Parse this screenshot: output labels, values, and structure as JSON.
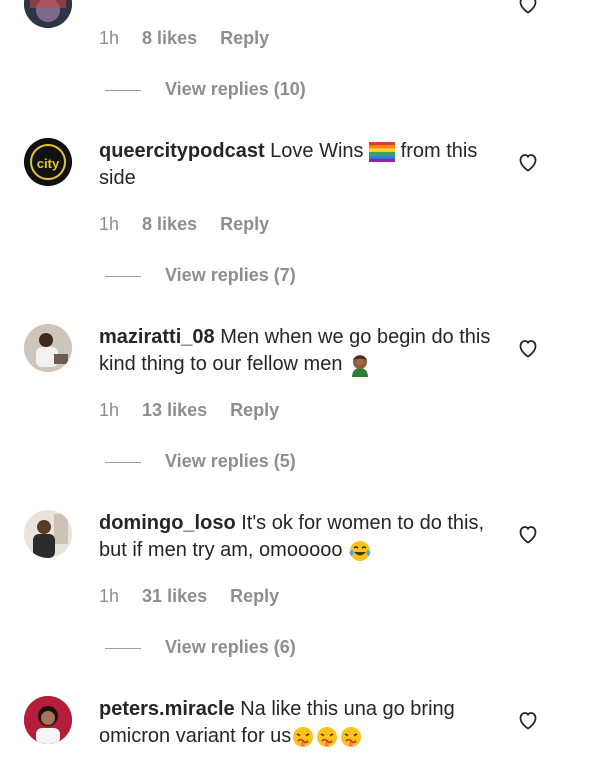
{
  "comments": [
    {
      "username": "",
      "text": "",
      "time": "1h",
      "likes": "8 likes",
      "reply": "Reply",
      "view_replies": "View replies (10)"
    },
    {
      "username": "queercitypodcast",
      "text": "Love Wins",
      "text_after": "from this side",
      "avatar_text": "city",
      "time": "1h",
      "likes": "8 likes",
      "reply": "Reply",
      "view_replies": "View replies (7)"
    },
    {
      "username": "maziratti_08",
      "text": "Men when we go begin do this kind thing to our fellow men",
      "time": "1h",
      "likes": "13 likes",
      "reply": "Reply",
      "view_replies": "View replies (5)"
    },
    {
      "username": "domingo_loso",
      "text": "It's ok for women to do this, but if men try am, omooooo",
      "time": "1h",
      "likes": "31 likes",
      "reply": "Reply",
      "view_replies": "View replies (6)"
    },
    {
      "username": "peters.miracle",
      "text": "Na like this una go bring omicron variant for us",
      "time": "",
      "likes": "",
      "reply": "",
      "view_replies": ""
    }
  ],
  "icons": {
    "like": "heart-outline-icon",
    "rainbow_flag": "rainbow-flag-emoji",
    "facepalm": "man-facepalming-emoji",
    "laugh": "tears-of-joy-emoji",
    "sick": "nauseated-face-emoji"
  }
}
